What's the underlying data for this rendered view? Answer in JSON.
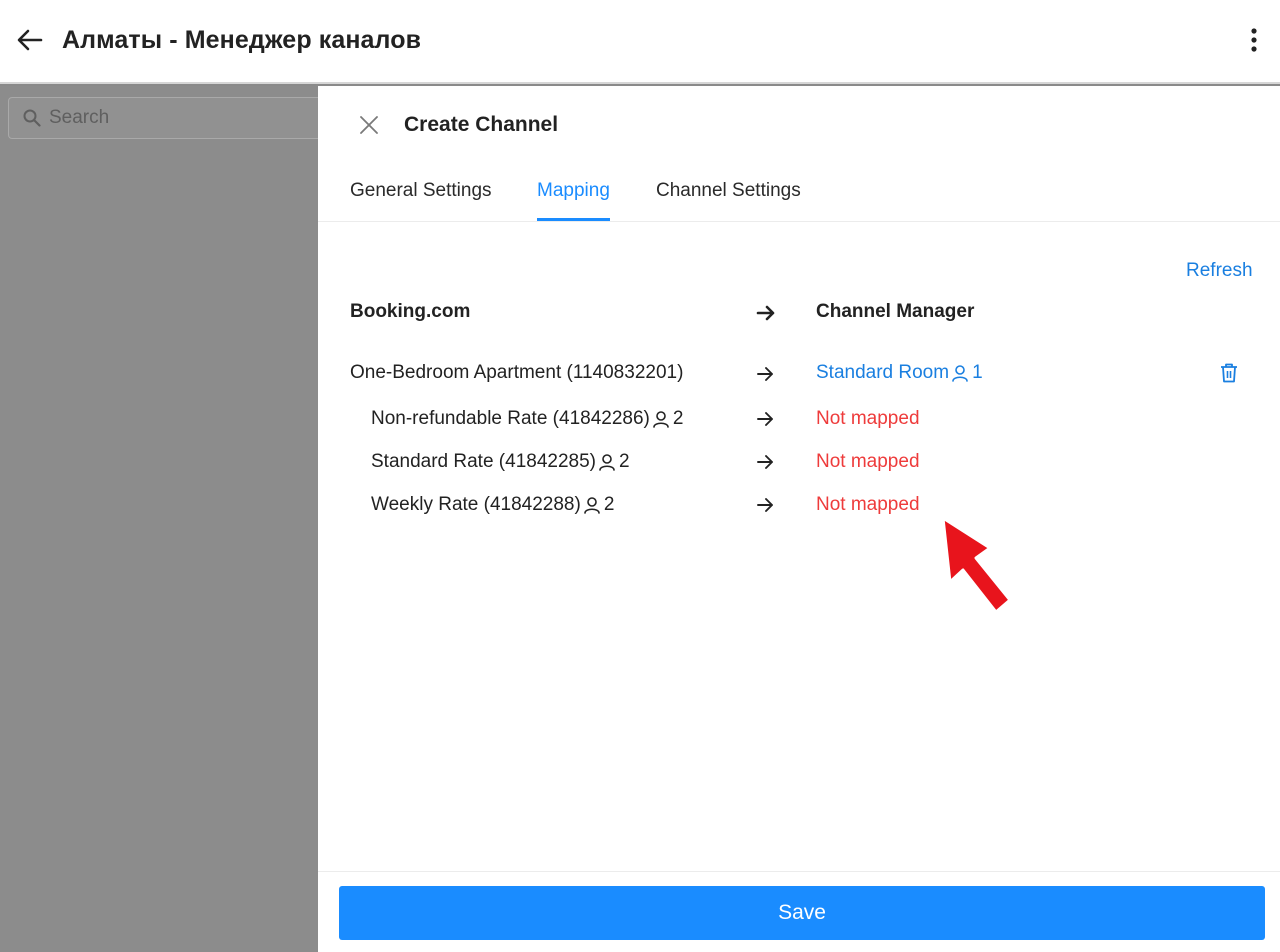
{
  "appbar": {
    "title": "Алматы - Менеджер каналов"
  },
  "background": {
    "search_placeholder": "Search"
  },
  "drawer": {
    "title": "Create Channel",
    "tabs": [
      {
        "label": "General Settings",
        "active": false
      },
      {
        "label": "Mapping",
        "active": true
      },
      {
        "label": "Channel Settings",
        "active": false
      }
    ],
    "refresh_label": "Refresh",
    "columns": {
      "left": "Booking.com",
      "right": "Channel Manager"
    },
    "rows": [
      {
        "source": "One-Bedroom Apartment (1140832201)",
        "source_occupancy": "",
        "target": "Standard Room",
        "target_occupancy": "1",
        "status": "mapped"
      },
      {
        "source": "Non-refundable Rate (41842286)",
        "source_occupancy": "2",
        "target": "Not mapped",
        "status": "not-mapped"
      },
      {
        "source": "Standard Rate (41842285)",
        "source_occupancy": "2",
        "target": "Not mapped",
        "status": "not-mapped"
      },
      {
        "source": "Weekly Rate (41842288)",
        "source_occupancy": "2",
        "target": "Not mapped",
        "status": "not-mapped"
      }
    ],
    "save_label": "Save"
  },
  "icons": {
    "back": "arrow-left-icon",
    "more": "more-vertical-icon",
    "close": "close-icon",
    "search": "search-icon",
    "arrow": "arrow-right-icon",
    "person": "person-icon",
    "trash": "trash-icon"
  },
  "colors": {
    "accent": "#1a8cff",
    "link": "#1a7fe0",
    "error": "#ee3b3b",
    "annotation": "#e8141c"
  }
}
